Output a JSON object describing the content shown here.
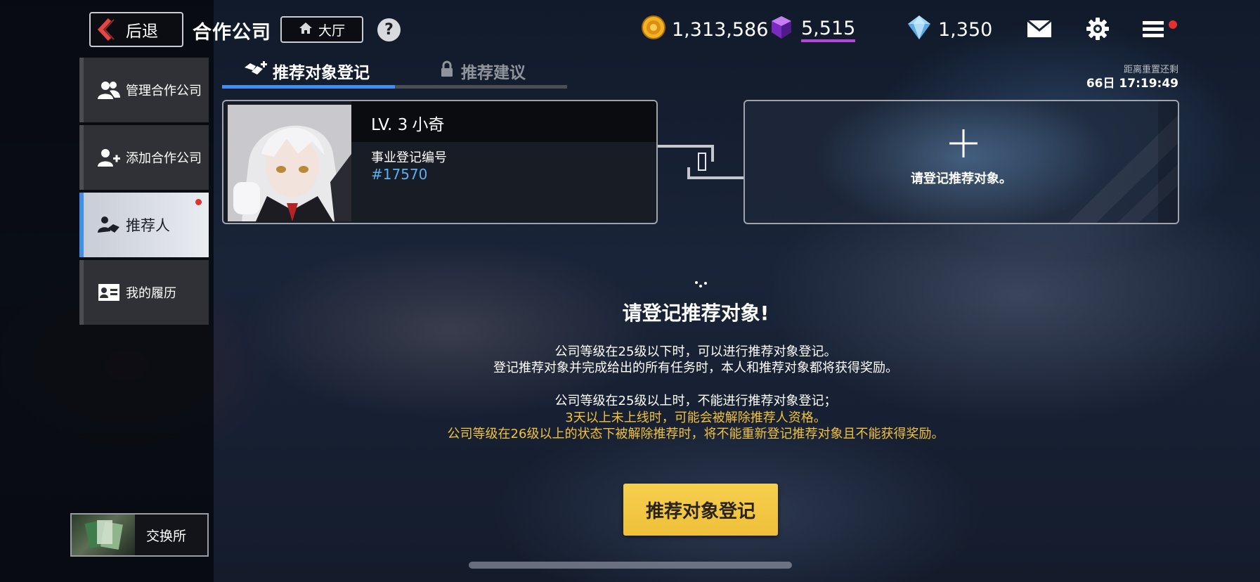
{
  "header": {
    "back_label": "后退",
    "title": "合作公司",
    "lobby_label": "大厅",
    "help_label": "?"
  },
  "currency": {
    "gold": "1,313,586",
    "gem": "5,515",
    "crystal": "1,350"
  },
  "sidebar": {
    "items": [
      {
        "label": "管理合作公司",
        "icon": "users-icon"
      },
      {
        "label": "添加合作公司",
        "icon": "add-user-icon"
      },
      {
        "label": "推荐人",
        "icon": "handshake-icon"
      },
      {
        "label": "我的履历",
        "icon": "id-card-icon"
      }
    ],
    "exchange_label": "交换所"
  },
  "tabs": [
    {
      "label": "推荐对象登记",
      "active": true
    },
    {
      "label": "推荐建议",
      "locked": true
    }
  ],
  "reset": {
    "label": "距离重置还剩",
    "time": "66日  17:19:49"
  },
  "profile": {
    "level": "LV. 3",
    "name": "小奇",
    "reg_label": "事业登记编号",
    "reg_number": "#17570"
  },
  "add_card": {
    "label": "请登记推荐对象。"
  },
  "message": {
    "title": "请登记推荐对象!",
    "line1": "公司等级在25级以下时，可以进行推荐对象登记。",
    "line2": "登记推荐对象并完成给出的所有任务时，本人和推荐对象都将获得奖励。",
    "line3": "公司等级在25级以上时，不能进行推荐对象登记；",
    "warn1": "3天以上未上线时，可能会被解除推荐人资格。",
    "warn2": "公司等级在26级以上的状态下被解除推荐时，将不能重新登记推荐对象且不能获得奖励。"
  },
  "register_button": "推荐对象登记",
  "colors": {
    "accent_blue": "#3f8ef0",
    "warn_yellow": "#f2c23a",
    "button_yellow": "#efc03a",
    "reg_number_blue": "#5ab0f2",
    "notification_red": "#e53030"
  }
}
